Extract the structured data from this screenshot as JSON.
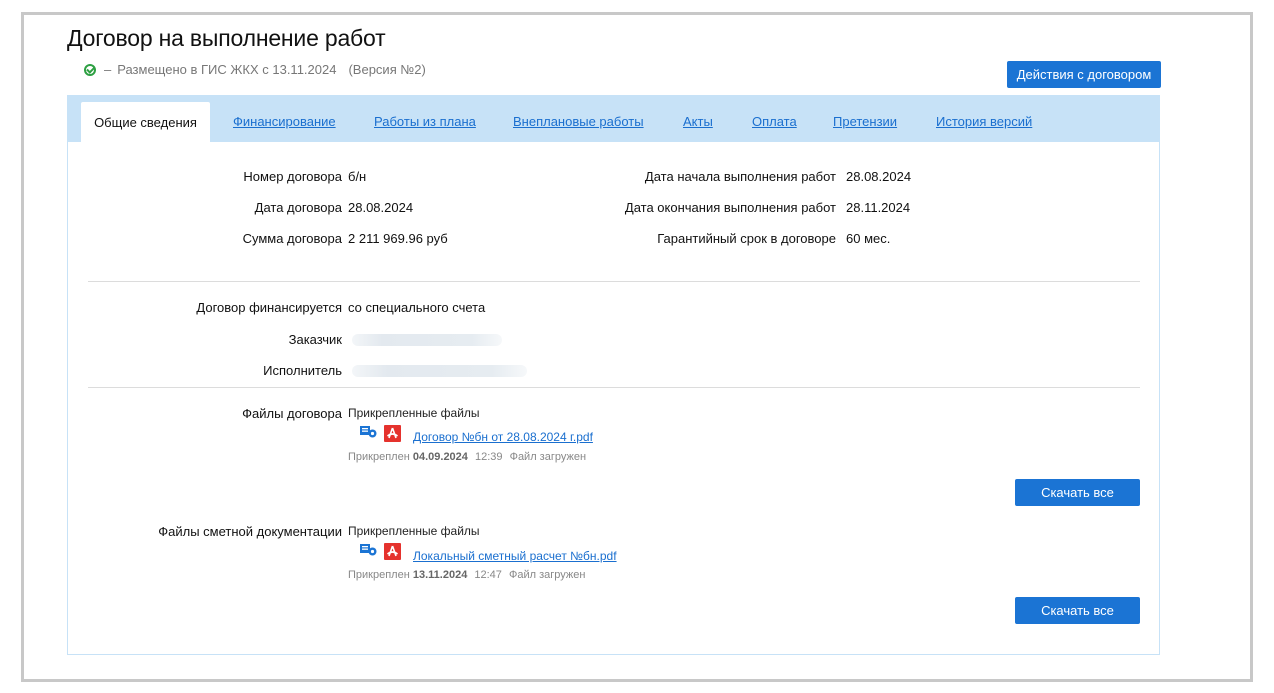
{
  "page": {
    "title": "Договор на выполнение работ",
    "status_dash": "–",
    "status_text": "Размещено в ГИС ЖКХ с 13.11.2024",
    "version": "(Версия №2)",
    "actions_button": "Действия с договором"
  },
  "tabs": [
    {
      "label": "Общие сведения",
      "active": true
    },
    {
      "label": "Финансирование"
    },
    {
      "label": "Работы из плана"
    },
    {
      "label": "Внеплановые работы"
    },
    {
      "label": "Акты"
    },
    {
      "label": "Оплата"
    },
    {
      "label": "Претензии"
    },
    {
      "label": "История версий"
    }
  ],
  "general": {
    "number_label": "Номер договора",
    "number_value": "б/н",
    "date_label": "Дата договора",
    "date_value": "28.08.2024",
    "sum_label": "Сумма договора",
    "sum_value": "2 211 969.96 руб",
    "start_label": "Дата начала выполнения работ",
    "start_value": "28.08.2024",
    "end_label": "Дата окончания выполнения работ",
    "end_value": "28.11.2024",
    "warranty_label": "Гарантийный срок в договоре",
    "warranty_value": "60 мес."
  },
  "parties": {
    "financing_label": "Договор финансируется",
    "financing_value": "со специального счета",
    "customer_label": "Заказчик",
    "contractor_label": "Исполнитель"
  },
  "contract_files": {
    "label": "Файлы договора",
    "attached_title": "Прикрепленные файлы",
    "file_name": "Договор №бн от 28.08.2024 г.pdf",
    "attached_prefix": "Прикреплен",
    "attached_date": "04.09.2024",
    "attached_time": "12:39",
    "status": "Файл загружен",
    "download_all": "Скачать все"
  },
  "estimate_files": {
    "label": "Файлы сметной документации",
    "attached_title": "Прикрепленные файлы",
    "file_name": "Локальный сметный расчет №бн.pdf",
    "attached_prefix": "Прикреплен",
    "attached_date": "13.11.2024",
    "attached_time": "12:47",
    "status": "Файл загружен",
    "download_all": "Скачать все"
  },
  "colors": {
    "accent": "#1b74d4",
    "tabbar": "#c7e2f7",
    "link": "#1a6fcf",
    "status_ok": "#2ea043",
    "pdf": "#e5322d"
  }
}
